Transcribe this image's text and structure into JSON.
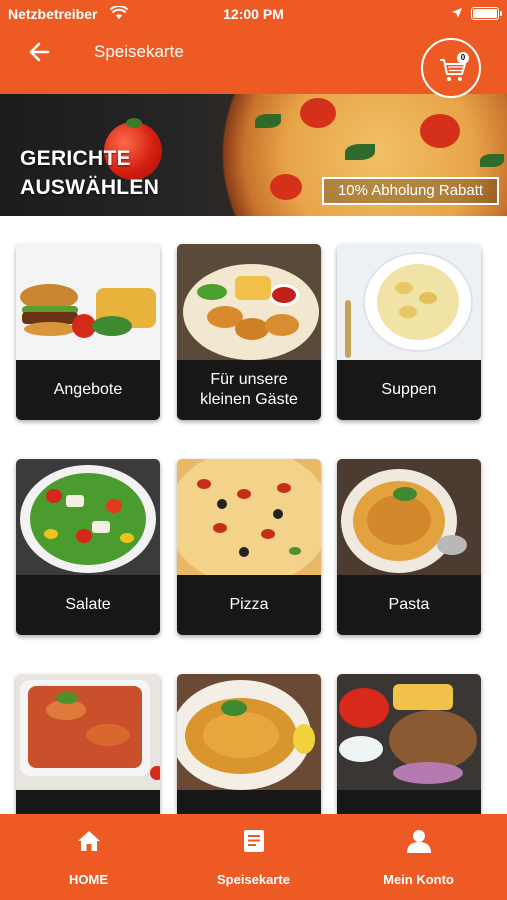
{
  "status_bar": {
    "carrier": "Netzbetreiber",
    "time": "12:00 PM"
  },
  "header": {
    "title": "Speisekarte",
    "cart_count": "0"
  },
  "banner": {
    "headline_line1": "GERICHTE",
    "headline_line2": "AUSWÄHLEN",
    "badge": "10% Abholung Rabatt"
  },
  "categories": [
    {
      "label": "Angebote",
      "icon": "burger-image"
    },
    {
      "label": "Für unsere kleinen Gäste",
      "icon": "nuggets-image"
    },
    {
      "label": "Suppen",
      "icon": "soup-image"
    },
    {
      "label": "Salate",
      "icon": "salad-image"
    },
    {
      "label": "Pizza",
      "icon": "pizza-image"
    },
    {
      "label": "Pasta",
      "icon": "pasta-image"
    },
    {
      "label": "",
      "icon": "lasagna-image"
    },
    {
      "label": "",
      "icon": "schnitzel-image"
    },
    {
      "label": "",
      "icon": "doner-image"
    }
  ],
  "tabbar": {
    "items": [
      {
        "label": "HOME",
        "icon": "home-icon"
      },
      {
        "label": "Speisekarte",
        "icon": "menu-list-icon"
      },
      {
        "label": "Mein Konto",
        "icon": "user-icon"
      }
    ]
  },
  "colors": {
    "accent": "#ee5a24",
    "card_label_bg": "#171717"
  }
}
